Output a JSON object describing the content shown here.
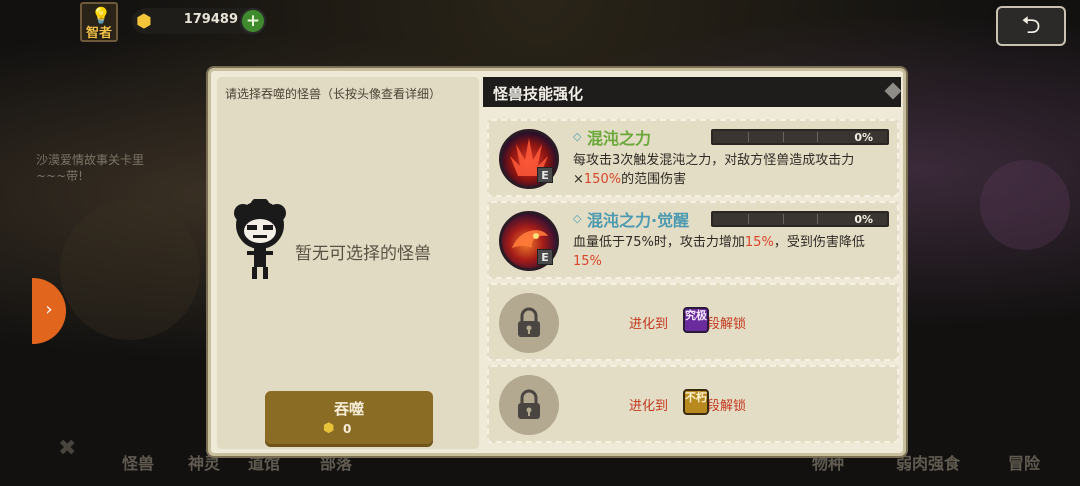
{
  "hud": {
    "rank_label": "智者",
    "currency_value": "179489",
    "plus_label": "+",
    "back_label": "⮌"
  },
  "background": {
    "note_text": "沙漠爱情故事关卡里\n~~~带!",
    "side_tab_arrow": "›",
    "nav_items": [
      "怪兽",
      "神灵",
      "道馆",
      "部落",
      "物种",
      "弱肉强食",
      "冒险"
    ]
  },
  "devour_panel": {
    "title": "请选择吞噬的怪兽（长按头像查看详细）",
    "empty_text": "暂无可选择的怪兽",
    "button_label": "吞噬",
    "cost_value": "0"
  },
  "skills_panel": {
    "title": "怪兽技能强化",
    "skills": [
      {
        "name": "混沌之力",
        "grade": "E",
        "progress_percent": 0,
        "progress_label": "0%",
        "desc_pre": "每攻击3次触发混沌之力，对敌方怪兽造成攻击力×",
        "desc_hl": "150%",
        "desc_post": "的范围伤害",
        "icon": "chaos-power-icon"
      },
      {
        "name": "混沌之力·觉醒",
        "grade": "E",
        "progress_percent": 0,
        "progress_label": "0%",
        "desc_pre": "血量低于75%时，攻击力增加",
        "desc_hl": "15%",
        "desc_mid": "，受到伤害降低",
        "desc_hl2": "15%",
        "icon": "chaos-awaken-icon"
      }
    ],
    "locked": [
      {
        "text_pre": "进化到",
        "badge": "究极",
        "text_post": "阶段解锁",
        "badge_color": "#6a2b9c"
      },
      {
        "text_pre": "进化到",
        "badge": "不朽",
        "text_post": "阶段解锁",
        "badge_color": "#b8891e"
      }
    ]
  },
  "colors": {
    "accent_red": "#d8462a",
    "skill_name_green": "#6aa83a",
    "skill_name_blue": "#4d9ab0",
    "button_gold": "#8b6c24"
  }
}
